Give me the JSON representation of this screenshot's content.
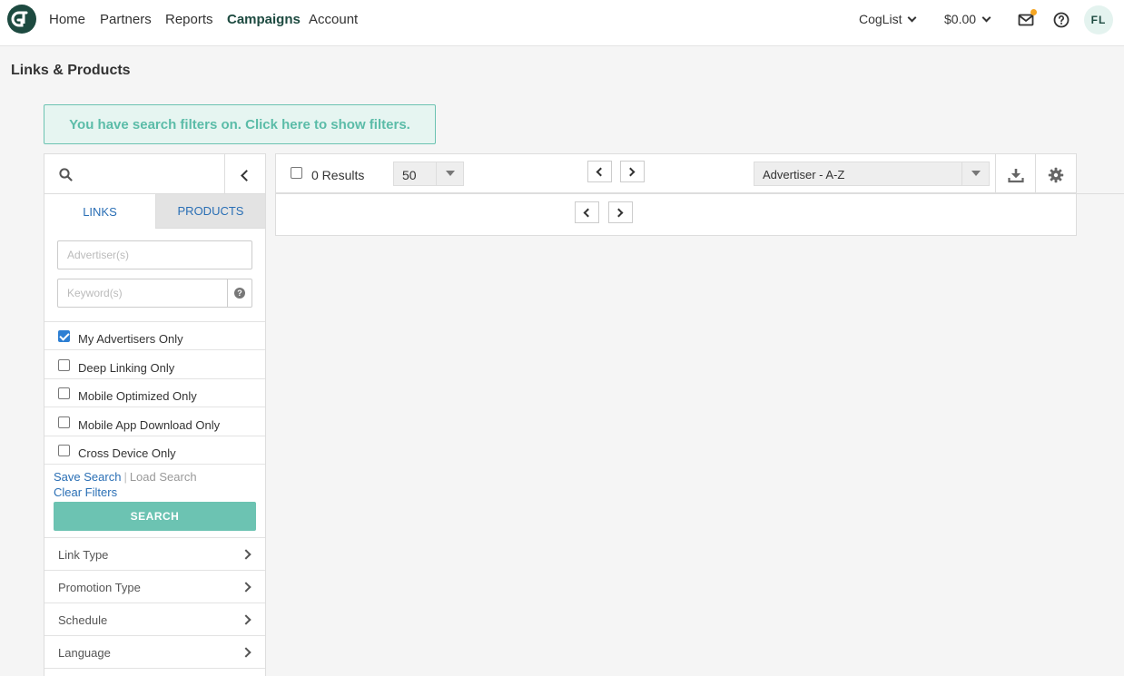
{
  "nav": {
    "items": [
      "Home",
      "Partners",
      "Reports",
      "Campaigns",
      "Account"
    ],
    "active": "Campaigns",
    "account_switch": "CogList",
    "balance": "$0.00",
    "avatar_initials": "FL"
  },
  "page": {
    "title": "Links & Products",
    "filter_banner": "You have search filters on. Click here to show filters."
  },
  "sidebar": {
    "tabs": {
      "links": "LINKS",
      "products": "PRODUCTS"
    },
    "advertiser_placeholder": "Advertiser(s)",
    "keyword_placeholder": "Keyword(s)",
    "checkboxes": [
      {
        "label": "My Advertisers Only",
        "checked": true
      },
      {
        "label": "Deep Linking Only",
        "checked": false
      },
      {
        "label": "Mobile Optimized Only",
        "checked": false
      },
      {
        "label": "Mobile App Download Only",
        "checked": false
      },
      {
        "label": "Cross Device Only",
        "checked": false
      }
    ],
    "save_search": "Save Search",
    "load_search": "Load Search",
    "clear_filters": "Clear Filters",
    "search_button": "SEARCH",
    "accordions": [
      "Link Type",
      "Promotion Type",
      "Schedule",
      "Language"
    ]
  },
  "results": {
    "count_label": "0 Results",
    "per_page": "50",
    "sort": "Advertiser - A-Z"
  },
  "colors": {
    "brand": "#1d4a40",
    "accent": "#6cc3b2",
    "link": "#2a6fb5",
    "notification": "#f5a623"
  }
}
